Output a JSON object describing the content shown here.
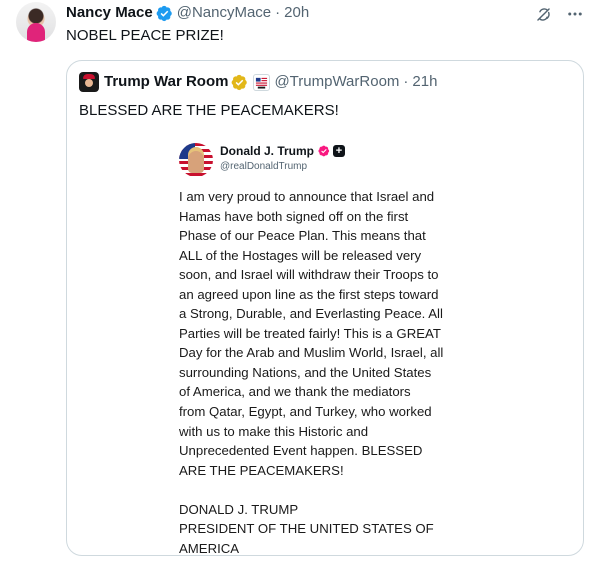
{
  "author": {
    "name": "Nancy Mace",
    "handle": "@NancyMace",
    "separator": "·",
    "time": "20h",
    "verified_color": "#1d9bf0"
  },
  "tweet": {
    "text": "NOBEL PEACE PRIZE!"
  },
  "quote": {
    "name": "Trump War Room",
    "handle": "@TrumpWarRoom",
    "separator": "·",
    "time": "21h",
    "verified_color": "#e2b719",
    "text": "BLESSED ARE THE PEACEMAKERS!"
  },
  "embedded_post": {
    "name": "Donald J. Trump",
    "handle": "@realDonaldTrump",
    "badge_color": "#f91880",
    "lines": [
      "I am very proud to announce that Israel and",
      "Hamas have both signed off on the first",
      "Phase of our Peace Plan. This means that",
      "ALL of the Hostages will be released very",
      "soon, and Israel will withdraw their Troops to",
      "an agreed upon line as the first steps toward",
      "a Strong, Durable, and Everlasting Peace. All",
      "Parties will be treated fairly! This is a GREAT",
      "Day for the Arab and Muslim World, Israel, all",
      "surrounding Nations, and the United States",
      "of America, and we thank the mediators",
      "from Qatar, Egypt, and Turkey, who worked",
      "with us to make this Historic and",
      "Unprecedented Event happen. BLESSED",
      "ARE THE PEACEMAKERS!",
      "",
      "DONALD J. TRUMP",
      "PRESIDENT OF THE UNITED STATES OF",
      "AMERICA"
    ]
  },
  "icons": {
    "grok": "grok-icon",
    "more": "more-icon"
  }
}
